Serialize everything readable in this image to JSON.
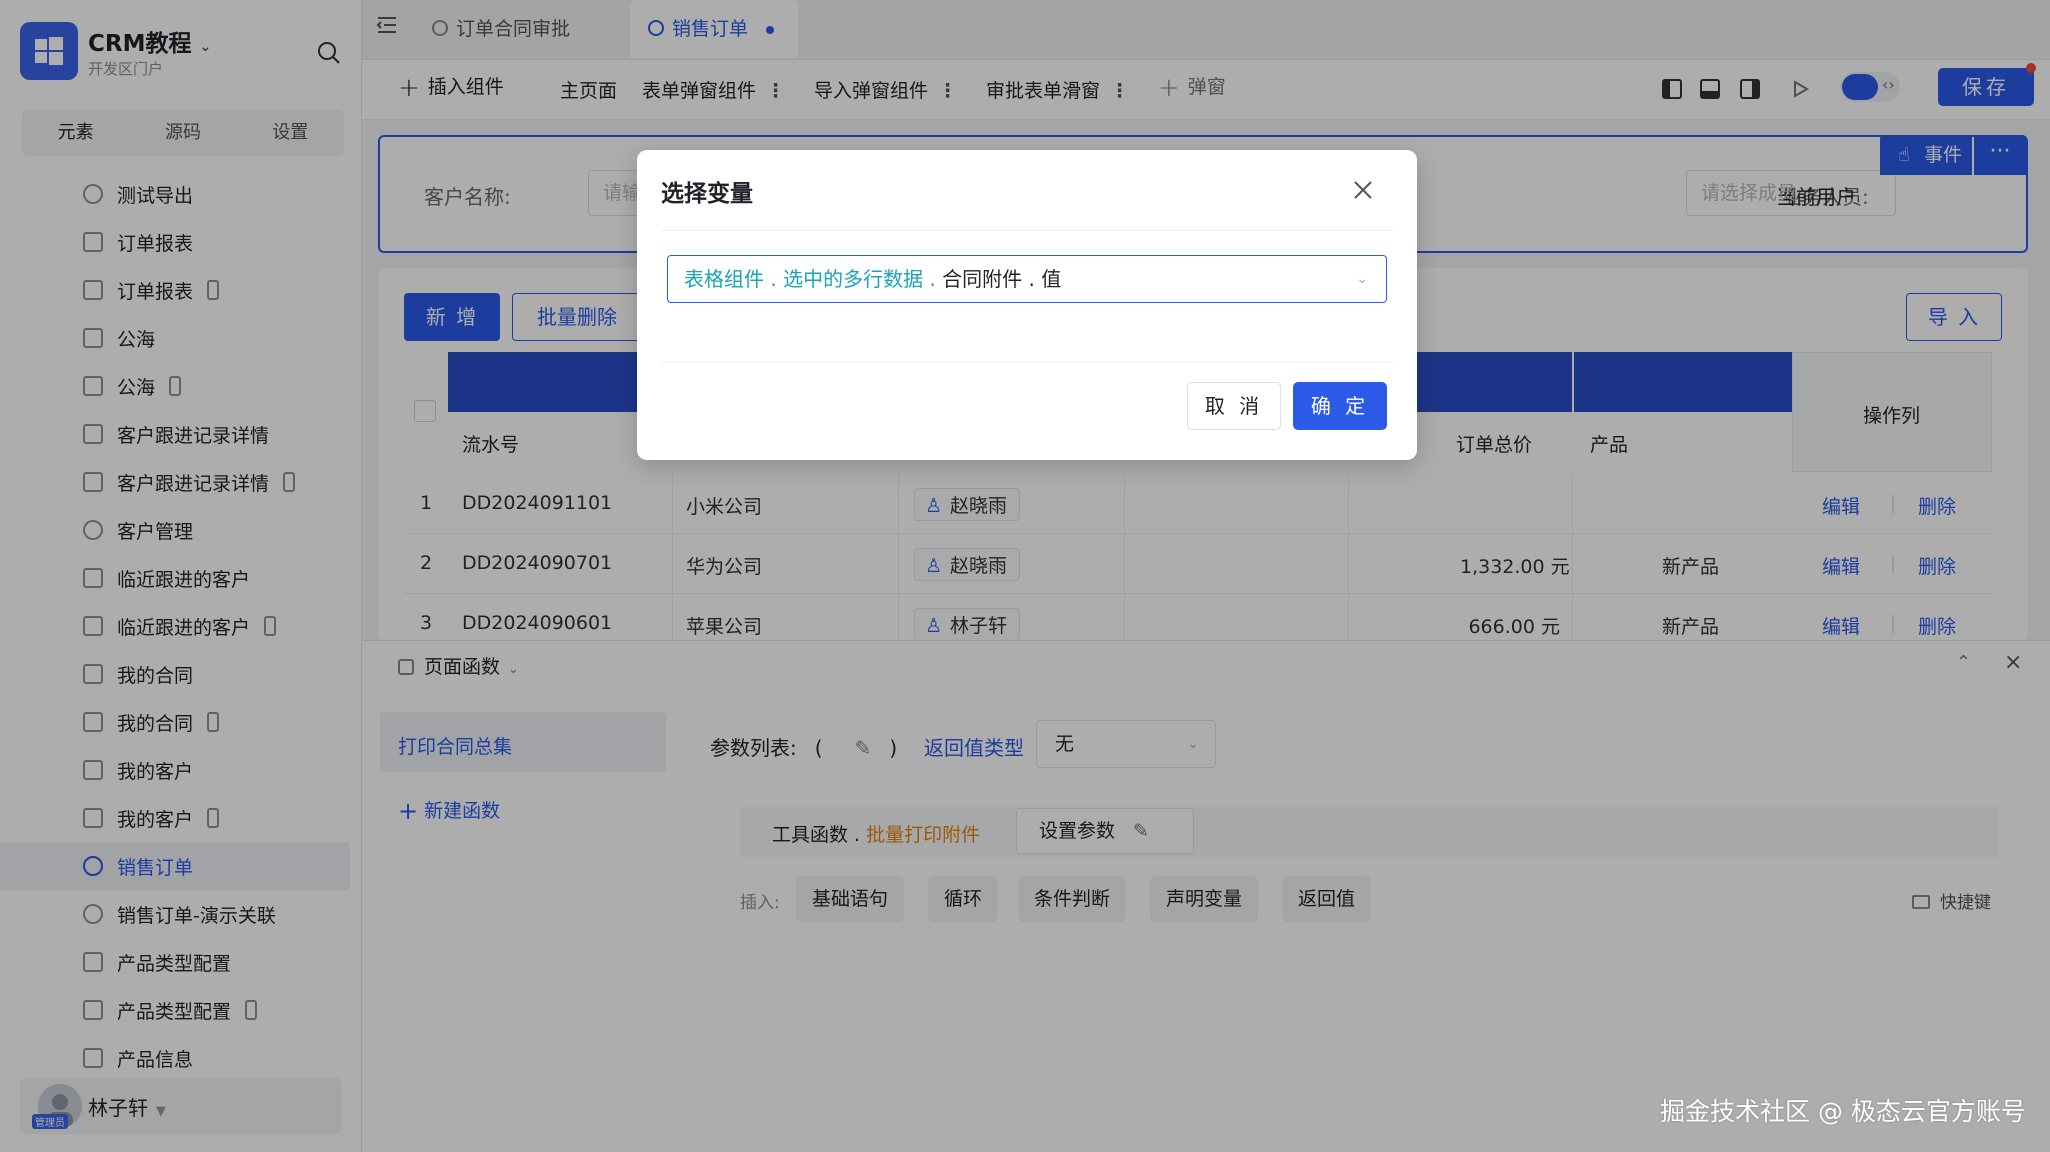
{
  "app": {
    "title": "CRM教程",
    "subtitle": "开发区门户"
  },
  "sidebar": {
    "tabs": [
      "元素",
      "源码",
      "设置"
    ],
    "items": [
      {
        "label": "测试导出",
        "icon": "clock-icon",
        "mobile": false
      },
      {
        "label": "订单报表",
        "icon": "page-icon",
        "mobile": false
      },
      {
        "label": "订单报表",
        "icon": "page-icon",
        "mobile": true
      },
      {
        "label": "公海",
        "icon": "page-icon",
        "mobile": false
      },
      {
        "label": "公海",
        "icon": "page-icon",
        "mobile": true
      },
      {
        "label": "客户跟进记录详情",
        "icon": "page-icon",
        "mobile": false
      },
      {
        "label": "客户跟进记录详情",
        "icon": "page-icon",
        "mobile": true
      },
      {
        "label": "客户管理",
        "icon": "clock-icon",
        "mobile": false
      },
      {
        "label": "临近跟进的客户",
        "icon": "page-icon",
        "mobile": false
      },
      {
        "label": "临近跟进的客户",
        "icon": "page-icon",
        "mobile": true
      },
      {
        "label": "我的合同",
        "icon": "page-icon",
        "mobile": false
      },
      {
        "label": "我的合同",
        "icon": "page-icon",
        "mobile": true
      },
      {
        "label": "我的客户",
        "icon": "page-icon",
        "mobile": false
      },
      {
        "label": "我的客户",
        "icon": "page-icon",
        "mobile": true
      },
      {
        "label": "销售订单",
        "icon": "clock-icon",
        "mobile": false,
        "active": true
      },
      {
        "label": "销售订单-演示关联",
        "icon": "clock-icon",
        "mobile": false
      },
      {
        "label": "产品类型配置",
        "icon": "table-icon",
        "mobile": false
      },
      {
        "label": "产品类型配置",
        "icon": "table-icon",
        "mobile": true
      },
      {
        "label": "产品信息",
        "icon": "table-icon",
        "mobile": false
      }
    ],
    "user": {
      "name": "林子轩",
      "role": "管理员"
    }
  },
  "tabs": [
    {
      "label": "订单合同审批",
      "active": false
    },
    {
      "label": "销售订单",
      "active": true
    }
  ],
  "toolbar": {
    "insert": "插入组件",
    "main_page": "主页面",
    "form_popup": "表单弹窗组件",
    "import_popup": "导入弹窗组件",
    "approval_drawer": "审批表单滑窗",
    "popup": "弹窗",
    "save": "保存"
  },
  "filter": {
    "customer_label": "客户名称:",
    "customer_placeholder": "请输",
    "sales_label": "业务人员:",
    "sales_value": "当前用户",
    "member_placeholder": "请选择成员",
    "event_btn": "事件",
    "more_btn": "···"
  },
  "table": {
    "add_btn": "新 增",
    "batch_delete_btn": "批量删除",
    "import_btn": "导 入",
    "headers": {
      "serial": "流水号",
      "total": "订单总价",
      "product": "产品",
      "ops": "操作列"
    },
    "rows": [
      {
        "idx": "1",
        "serial": "DD2024091101",
        "customer": "小米公司",
        "person": "赵晓雨",
        "total": "",
        "product": ""
      },
      {
        "idx": "2",
        "serial": "DD2024090701",
        "customer": "华为公司",
        "person": "赵晓雨",
        "total": "1,332.00 元",
        "product": "新产品"
      },
      {
        "idx": "3",
        "serial": "DD2024090601",
        "customer": "苹果公司",
        "person": "林子轩",
        "total": "666.00 元",
        "product": "新产品"
      }
    ],
    "edit": "编辑",
    "delete": "删除"
  },
  "bottom": {
    "title": "页面函数",
    "fn_item": "打印合同总集",
    "new_fn": "新建函数",
    "params_label": "参数列表:",
    "paren_open": "(",
    "paren_close": ")",
    "return_label": "返回值类型",
    "return_value": "无",
    "code_prefix": "工具函数 . ",
    "code_fn": "批量打印附件",
    "set_params": "设置参数",
    "insert_label": "插入:",
    "chips": [
      "基础语句",
      "循环",
      "条件判断",
      "声明变量",
      "返回值"
    ],
    "shortcut": "快捷键"
  },
  "modal": {
    "title": "选择变量",
    "select_seg1": "表格组件 . 选中的多行数据 . ",
    "select_seg2": "合同附件 . 值",
    "cancel": "取 消",
    "ok": "确 定"
  },
  "watermark": "掘金技术社区 @ 极态云官方账号",
  "colors": {
    "primary": "#2c5ae9",
    "header_band": "#2c4fc9",
    "warning": "#e6820e",
    "teal": "#1aa3b8"
  }
}
